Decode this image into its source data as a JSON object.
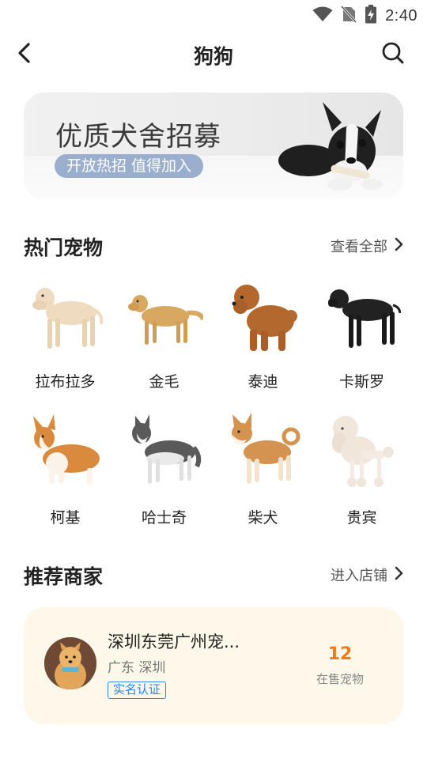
{
  "status_bar": {
    "time": "2:40",
    "icons": [
      "wifi-icon",
      "no-sim-icon",
      "battery-charging-icon"
    ]
  },
  "header": {
    "title": "狗狗",
    "back_icon": "chevron-left-icon",
    "search_icon": "search-icon"
  },
  "banner": {
    "title": "优质犬舍招募",
    "subtitle": "开放热招 值得加入"
  },
  "hot_pets": {
    "title": "热门宠物",
    "link_label": "查看全部",
    "items": [
      {
        "name": "拉布拉多",
        "color": "#efdcc0"
      },
      {
        "name": "金毛",
        "color": "#d9a860"
      },
      {
        "name": "泰迪",
        "color": "#b3692e"
      },
      {
        "name": "卡斯罗",
        "color": "#222222"
      },
      {
        "name": "柯基",
        "color": "#d98a3c"
      },
      {
        "name": "哈士奇",
        "color": "#5a5a5a"
      },
      {
        "name": "柴犬",
        "color": "#d49350"
      },
      {
        "name": "贵宾",
        "color": "#f1e6dc"
      }
    ]
  },
  "merchants": {
    "title": "推荐商家",
    "link_label": "进入店铺",
    "items": [
      {
        "name": "深圳东莞广州宠...",
        "location": "广东 深圳",
        "badge": "实名认证",
        "pets_count": "12",
        "pets_label": "在售宠物"
      }
    ]
  },
  "colors": {
    "accent_orange": "#f07a1a",
    "badge_blue": "#2f86e8",
    "card_bg": "#fdf8e9",
    "banner_pill": "#9aaecd"
  }
}
